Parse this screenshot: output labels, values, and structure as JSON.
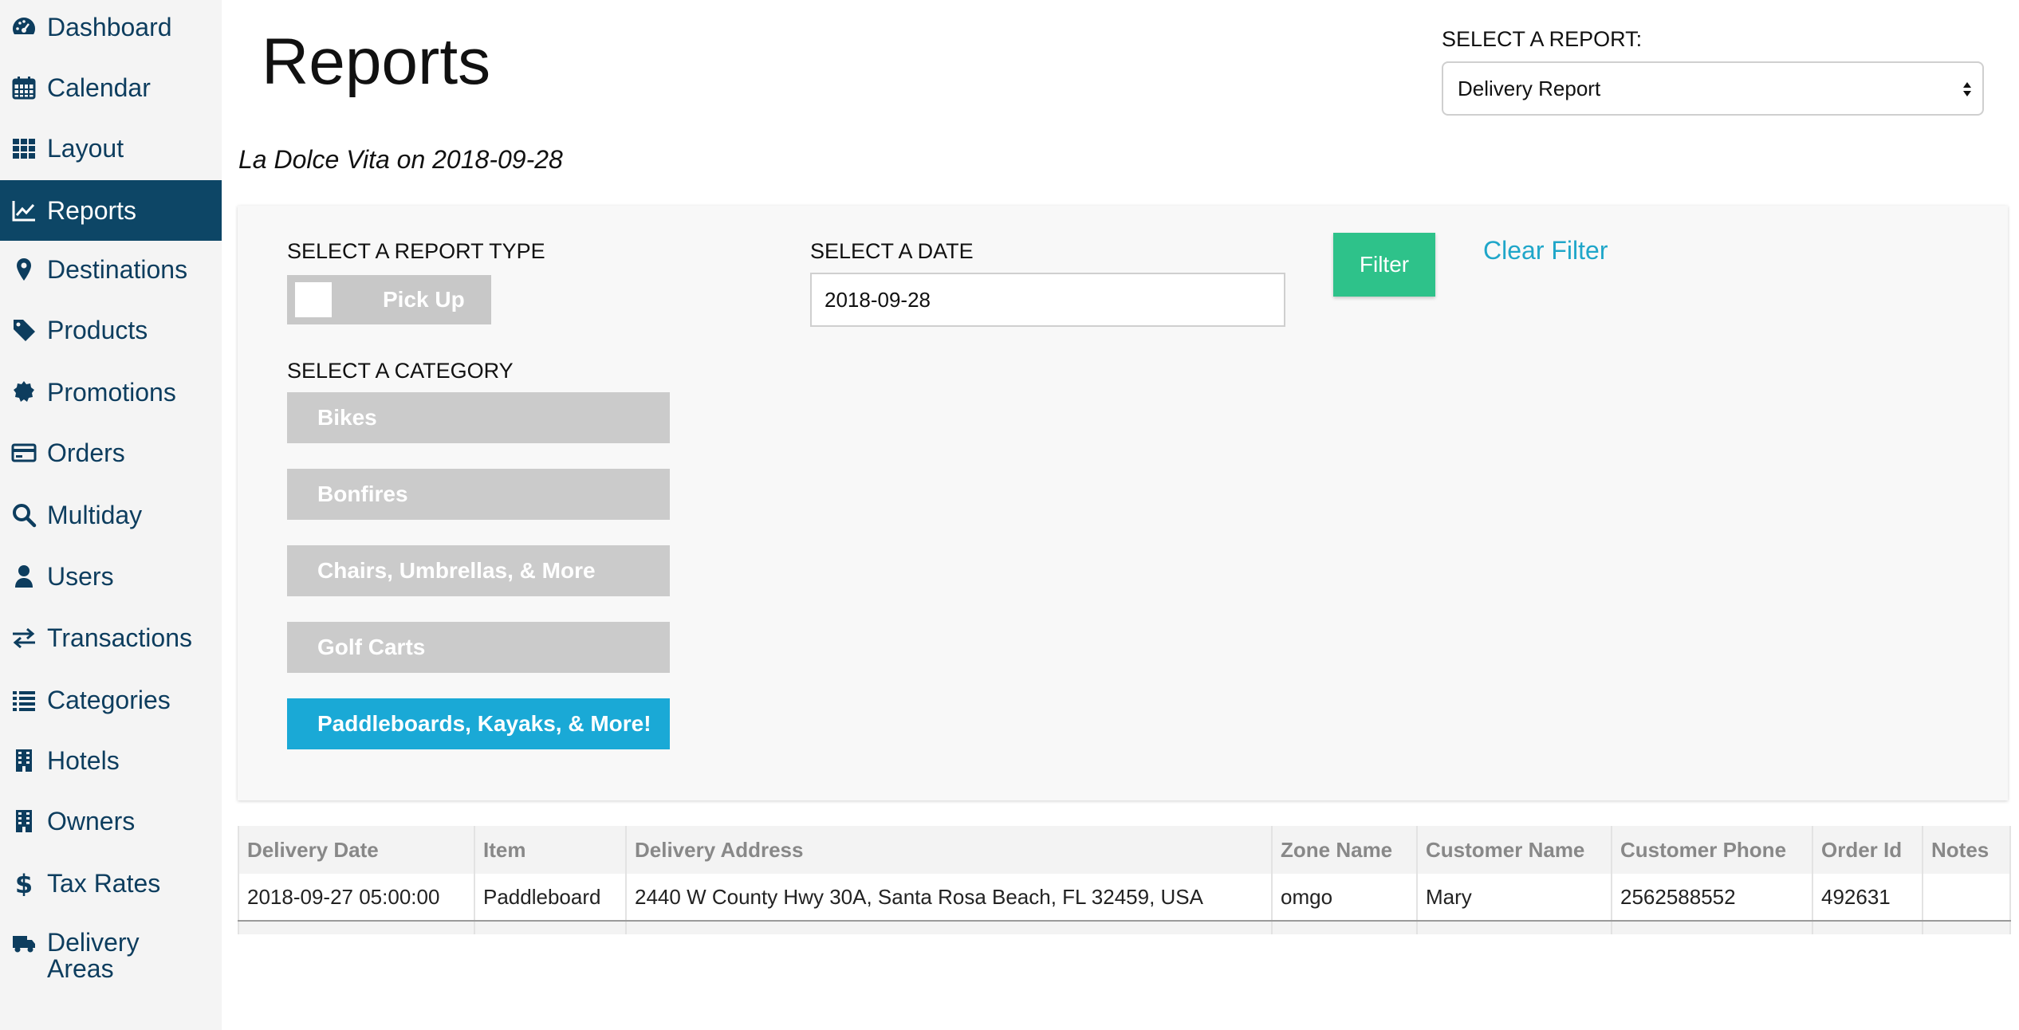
{
  "sidebar": {
    "items": [
      {
        "label": "Dashboard",
        "icon": "dashboard-icon"
      },
      {
        "label": "Calendar",
        "icon": "calendar-icon"
      },
      {
        "label": "Layout",
        "icon": "grid-icon"
      },
      {
        "label": "Reports",
        "icon": "chart-line-icon",
        "active": true
      },
      {
        "label": "Destinations",
        "icon": "map-marker-icon"
      },
      {
        "label": "Products",
        "icon": "tag-icon"
      },
      {
        "label": "Promotions",
        "icon": "certificate-icon"
      },
      {
        "label": "Orders",
        "icon": "credit-card-icon"
      },
      {
        "label": "Multiday",
        "icon": "search-icon"
      },
      {
        "label": "Users",
        "icon": "user-icon"
      },
      {
        "label": "Transactions",
        "icon": "exchange-icon"
      },
      {
        "label": "Categories",
        "icon": "list-icon"
      },
      {
        "label": "Hotels",
        "icon": "building-icon"
      },
      {
        "label": "Owners",
        "icon": "building-icon"
      },
      {
        "label": "Tax Rates",
        "icon": "dollar-icon"
      },
      {
        "label": "Delivery Areas",
        "icon": "truck-icon"
      }
    ]
  },
  "header": {
    "title": "Reports",
    "report_select_label": "SELECT A REPORT:",
    "report_select_value": "Delivery Report",
    "subtitle": "La Dolce Vita on 2018-09-28"
  },
  "filters": {
    "report_type_label": "SELECT A REPORT TYPE",
    "report_type_toggle": "Pick Up",
    "category_label": "SELECT A CATEGORY",
    "categories": [
      {
        "label": "Bikes",
        "active": false
      },
      {
        "label": "Bonfires",
        "active": false
      },
      {
        "label": "Chairs, Umbrellas, & More",
        "active": false
      },
      {
        "label": "Golf Carts",
        "active": false
      },
      {
        "label": "Paddleboards, Kayaks, & More!",
        "active": true
      }
    ],
    "date_label": "SELECT A DATE",
    "date_value": "2018-09-28",
    "filter_button": "Filter",
    "clear_filter": "Clear Filter"
  },
  "table": {
    "columns": [
      "Delivery Date",
      "Item",
      "Delivery Address",
      "Zone Name",
      "Customer Name",
      "Customer Phone",
      "Order Id",
      "Notes"
    ],
    "rows": [
      [
        "2018-09-27 05:00:00",
        "Paddleboard",
        "2440 W County Hwy 30A, Santa Rosa Beach, FL 32459, USA",
        "omgo",
        "Mary",
        "2562588552",
        "492631",
        ""
      ]
    ]
  },
  "colors": {
    "sidebar_active": "#0d4666",
    "sidebar_text": "#0d3d5e",
    "filter_button": "#2ec28a",
    "category_active": "#1aa9d6",
    "clear_link": "#1fa6c9"
  }
}
